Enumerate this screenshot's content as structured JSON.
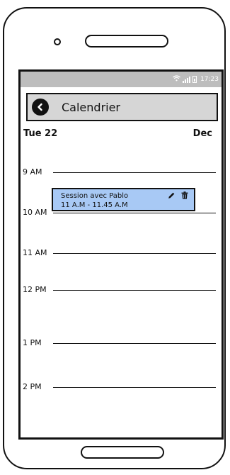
{
  "status_bar": {
    "icons": [
      "wifi-icon",
      "signal-icon",
      "battery-icon"
    ],
    "time": "17:23"
  },
  "app_bar": {
    "back_icon": "back-arrow-icon",
    "title": "Calendrier"
  },
  "date_header": {
    "day": "Tue 22",
    "month": "Dec"
  },
  "hours": [
    "9 AM",
    "10 AM",
    "11 AM",
    "12 PM",
    "1 PM",
    "2 PM"
  ],
  "event": {
    "title": "Session avec Pablo",
    "time": "11 A.M - 11.45 A.M",
    "color": "#a8c9f5",
    "actions": [
      "pencil-icon",
      "trash-icon"
    ]
  },
  "colors": {
    "status_bar": "#bdbdbd",
    "app_bar": "#d6d6d6",
    "event": "#a8c9f5"
  }
}
